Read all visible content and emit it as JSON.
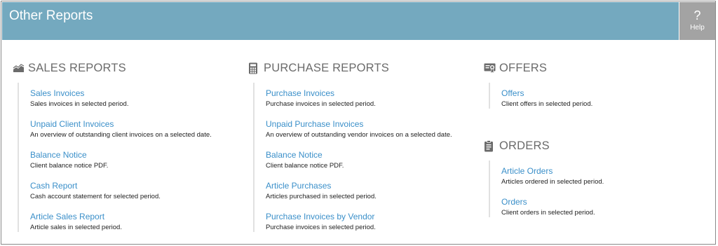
{
  "page": {
    "title": "Other Reports"
  },
  "help": {
    "symbol": "?",
    "label": "Help"
  },
  "sections": {
    "sales": {
      "title": "SALES REPORTS",
      "icon": "area-chart-icon",
      "items": [
        {
          "label": "Sales Invoices",
          "desc": "Sales invoices in selected period."
        },
        {
          "label": "Unpaid Client Invoices",
          "desc": "An overview of outstanding client invoices on a selected date."
        },
        {
          "label": "Balance Notice",
          "desc": "Client balance notice PDF."
        },
        {
          "label": "Cash Report",
          "desc": "Cash account statement for selected period."
        },
        {
          "label": "Article Sales Report",
          "desc": "Article sales in selected period."
        }
      ]
    },
    "purchase": {
      "title": "PURCHASE REPORTS",
      "icon": "calculator-icon",
      "items": [
        {
          "label": "Purchase Invoices",
          "desc": "Purchase invoices in selected period."
        },
        {
          "label": "Unpaid Purchase Invoices",
          "desc": "An overview of outstanding vendor invoices on a selected date."
        },
        {
          "label": "Balance Notice",
          "desc": "Client balance notice PDF."
        },
        {
          "label": "Article Purchases",
          "desc": "Articles purchased in selected period."
        },
        {
          "label": "Purchase Invoices by Vendor",
          "desc": "Purchase invoices in selected period."
        }
      ]
    },
    "offers": {
      "title": "OFFERS",
      "icon": "certificate-icon",
      "items": [
        {
          "label": "Offers",
          "desc": "Client offers in selected period."
        }
      ]
    },
    "orders": {
      "title": "ORDERS",
      "icon": "clipboard-icon",
      "items": [
        {
          "label": "Article Orders",
          "desc": "Articles ordered in selected period."
        },
        {
          "label": "Orders",
          "desc": "Client orders in selected period."
        }
      ]
    }
  },
  "colors": {
    "header": "#74a9bf",
    "help": "#a3a3a3",
    "link": "#3a8fc9",
    "section_title": "#6b6b6b"
  }
}
